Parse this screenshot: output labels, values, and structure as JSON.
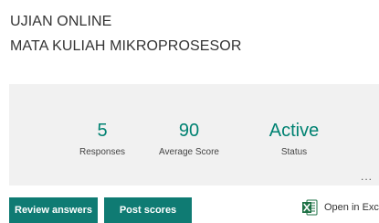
{
  "header": {
    "title_line1": "UJIAN ONLINE",
    "title_line2": "MATA KULIAH MIKROPROSESOR"
  },
  "summary": {
    "stats": [
      {
        "value": "5",
        "label": "Responses"
      },
      {
        "value": "90",
        "label": "Average Score"
      },
      {
        "value": "Active",
        "label": "Status"
      }
    ],
    "more_label": "..."
  },
  "actions": {
    "review_label": "Review answers",
    "post_label": "Post scores",
    "excel_label": "Open in Excel",
    "excel_icon": "excel-icon"
  },
  "colors": {
    "accent": "#008272",
    "button": "#0f7b73",
    "panel": "#f1f1f1",
    "excel_green": "#1e7145"
  }
}
